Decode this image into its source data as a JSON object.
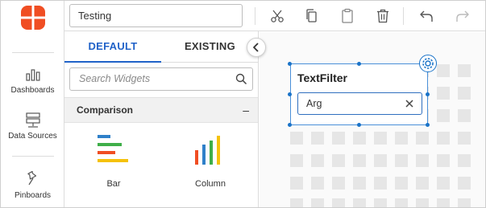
{
  "nav": {
    "items": [
      {
        "label": "Dashboards",
        "icon": "bar-chart-icon"
      },
      {
        "label": "Data Sources",
        "icon": "database-icon"
      },
      {
        "label": "Pinboards",
        "icon": "pin-icon"
      }
    ]
  },
  "toolbar": {
    "dashboard_name": "Testing",
    "buttons": [
      "cut-icon",
      "copy-icon",
      "paste-icon",
      "delete-icon",
      "undo-icon",
      "redo-icon"
    ]
  },
  "panel": {
    "tabs": [
      "DEFAULT",
      "EXISTING"
    ],
    "active_tab": "DEFAULT",
    "search_placeholder": "Search Widgets",
    "section_title": "Comparison",
    "section_toggle": "–",
    "widgets": [
      {
        "label": "Bar",
        "icon": "bar-widget-icon"
      },
      {
        "label": "Column",
        "icon": "column-widget-icon"
      }
    ]
  },
  "widget": {
    "title": "TextFilter",
    "value": "Arg"
  },
  "colors": {
    "accent": "#2062c8",
    "brand": "#f04e23",
    "selection": "#1a73c8"
  }
}
